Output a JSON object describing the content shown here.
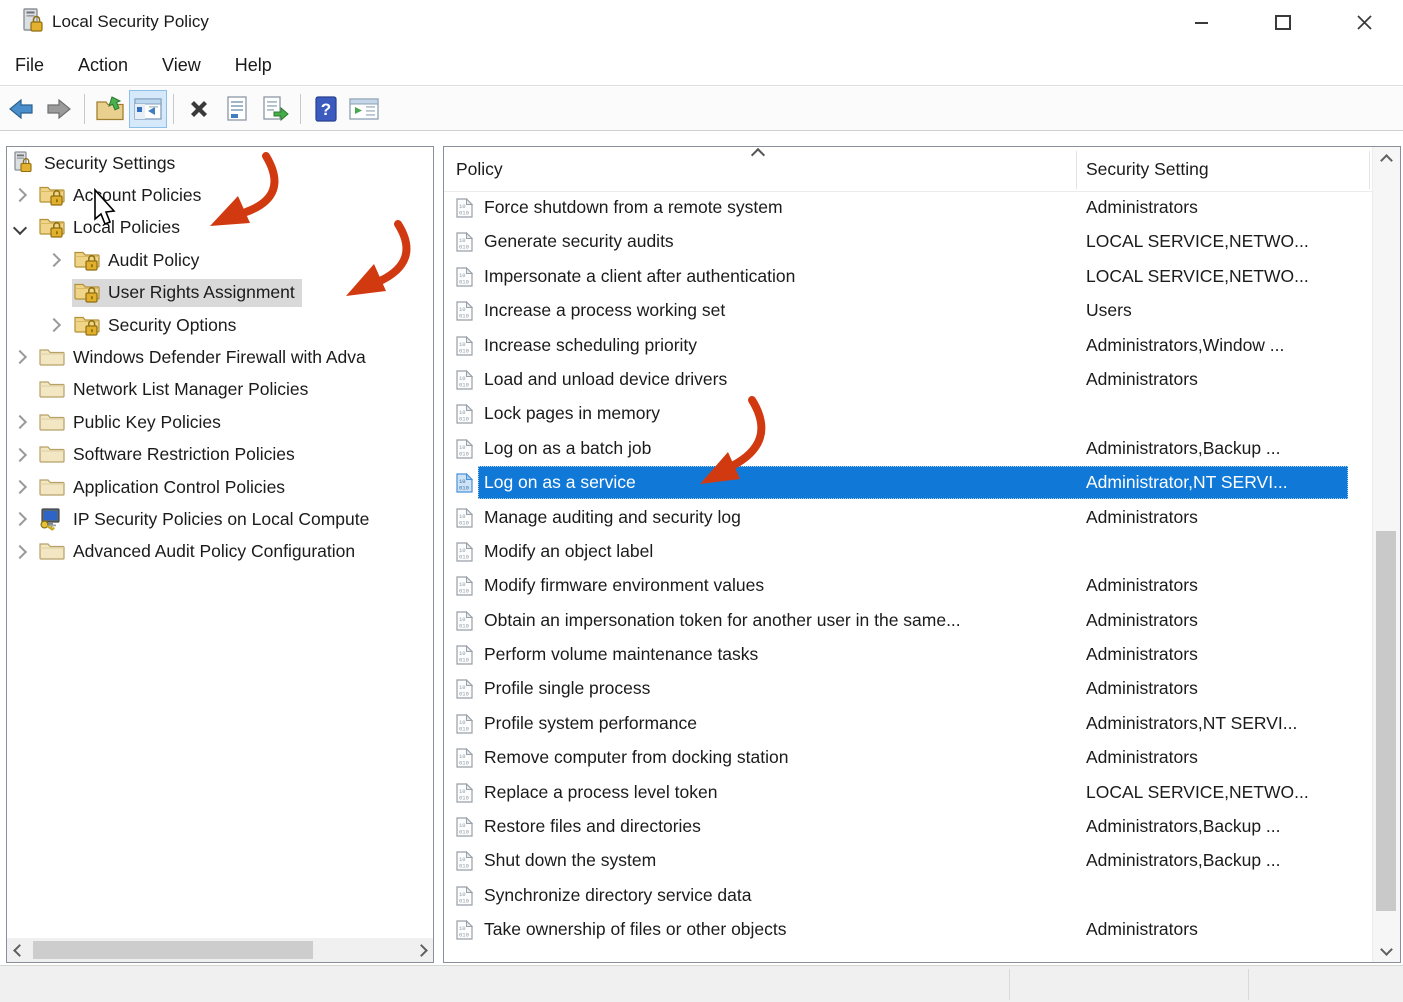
{
  "window": {
    "title": "Local Security Policy",
    "controls": [
      "minimize",
      "maximize",
      "close"
    ]
  },
  "menu": {
    "items": [
      "File",
      "Action",
      "View",
      "Help"
    ]
  },
  "toolbar": {
    "buttons": [
      "back",
      "forward",
      "separator",
      "up-one-level",
      "show-console-tree",
      "separator",
      "delete",
      "properties",
      "export-list",
      "separator",
      "help",
      "show-action-pane"
    ],
    "active": "show-console-tree"
  },
  "tree": {
    "items": [
      {
        "label": "Security Settings",
        "level": 0,
        "chevron": "none",
        "icon": "server-lock",
        "selected": false
      },
      {
        "label": "Account Policies",
        "level": 1,
        "chevron": "collapsed",
        "icon": "folder-lock",
        "selected": false
      },
      {
        "label": "Local Policies",
        "level": 1,
        "chevron": "expanded",
        "icon": "folder-lock",
        "selected": false
      },
      {
        "label": "Audit Policy",
        "level": 2,
        "chevron": "collapsed",
        "icon": "folder-lock",
        "selected": false
      },
      {
        "label": "User Rights Assignment",
        "level": 2,
        "chevron": "none",
        "icon": "folder-lock",
        "selected": true
      },
      {
        "label": "Security Options",
        "level": 2,
        "chevron": "collapsed",
        "icon": "folder-lock",
        "selected": false
      },
      {
        "label": "Windows Defender Firewall with Adva",
        "level": 1,
        "chevron": "collapsed",
        "icon": "folder",
        "selected": false
      },
      {
        "label": "Network List Manager Policies",
        "level": 1,
        "chevron": "none",
        "icon": "folder",
        "selected": false
      },
      {
        "label": "Public Key Policies",
        "level": 1,
        "chevron": "collapsed",
        "icon": "folder",
        "selected": false
      },
      {
        "label": "Software Restriction Policies",
        "level": 1,
        "chevron": "collapsed",
        "icon": "folder",
        "selected": false
      },
      {
        "label": "Application Control Policies",
        "level": 1,
        "chevron": "collapsed",
        "icon": "folder",
        "selected": false
      },
      {
        "label": "IP Security Policies on Local Compute",
        "level": 1,
        "chevron": "collapsed",
        "icon": "ipsec",
        "selected": false
      },
      {
        "label": "Advanced Audit Policy Configuration",
        "level": 1,
        "chevron": "collapsed",
        "icon": "folder",
        "selected": false
      }
    ]
  },
  "list": {
    "columns": [
      "Policy",
      "Security Setting"
    ],
    "rows": [
      {
        "policy": "Force shutdown from a remote system",
        "setting": "Administrators",
        "selected": false
      },
      {
        "policy": "Generate security audits",
        "setting": "LOCAL SERVICE,NETWO...",
        "selected": false
      },
      {
        "policy": "Impersonate a client after authentication",
        "setting": "LOCAL SERVICE,NETWO...",
        "selected": false
      },
      {
        "policy": "Increase a process working set",
        "setting": "Users",
        "selected": false
      },
      {
        "policy": "Increase scheduling priority",
        "setting": "Administrators,Window ...",
        "selected": false
      },
      {
        "policy": "Load and unload device drivers",
        "setting": "Administrators",
        "selected": false
      },
      {
        "policy": "Lock pages in memory",
        "setting": "",
        "selected": false
      },
      {
        "policy": "Log on as a batch job",
        "setting": "Administrators,Backup ...",
        "selected": false
      },
      {
        "policy": "Log on as a service",
        "setting": "Administrator,NT SERVI...",
        "selected": true
      },
      {
        "policy": "Manage auditing and security log",
        "setting": "Administrators",
        "selected": false
      },
      {
        "policy": "Modify an object label",
        "setting": "",
        "selected": false
      },
      {
        "policy": "Modify firmware environment values",
        "setting": "Administrators",
        "selected": false
      },
      {
        "policy": "Obtain an impersonation token for another user in the same...",
        "setting": "Administrators",
        "selected": false
      },
      {
        "policy": "Perform volume maintenance tasks",
        "setting": "Administrators",
        "selected": false
      },
      {
        "policy": "Profile single process",
        "setting": "Administrators",
        "selected": false
      },
      {
        "policy": "Profile system performance",
        "setting": "Administrators,NT SERVI...",
        "selected": false
      },
      {
        "policy": "Remove computer from docking station",
        "setting": "Administrators",
        "selected": false
      },
      {
        "policy": "Replace a process level token",
        "setting": "LOCAL SERVICE,NETWO...",
        "selected": false
      },
      {
        "policy": "Restore files and directories",
        "setting": "Administrators,Backup ...",
        "selected": false
      },
      {
        "policy": "Shut down the system",
        "setting": "Administrators,Backup ...",
        "selected": false
      },
      {
        "policy": "Synchronize directory service data",
        "setting": "",
        "selected": false
      },
      {
        "policy": "Take ownership of files or other objects",
        "setting": "Administrators",
        "selected": false
      }
    ]
  },
  "annotations": {
    "arrows": [
      "local-policies",
      "user-rights-assignment",
      "log-on-as-a-service"
    ],
    "cursor": "near-account-policies"
  },
  "colors": {
    "selection_blue": "#1079d8",
    "tree_selection_gray": "#d9d9d9",
    "arrow_red": "#d13a10"
  }
}
